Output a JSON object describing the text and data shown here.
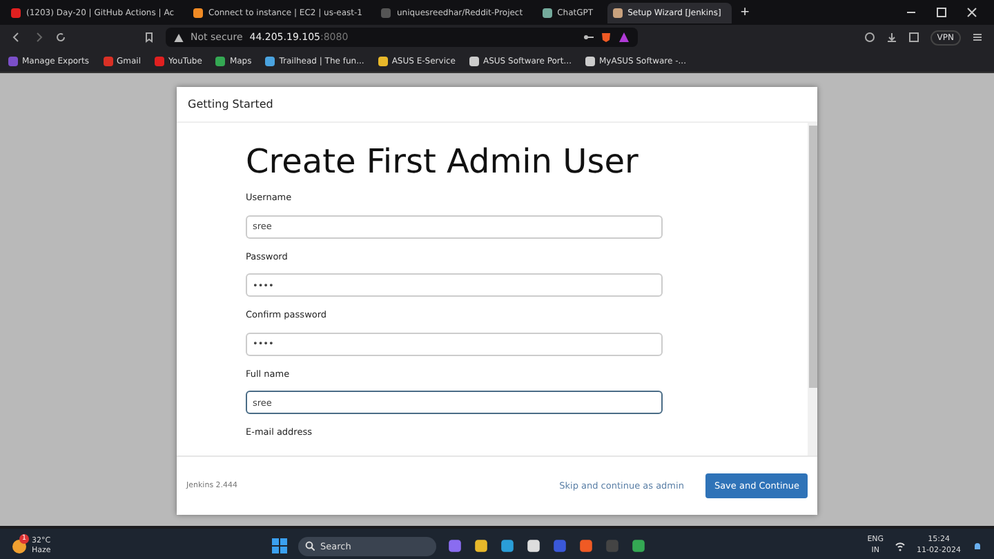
{
  "browser": {
    "tabs": [
      {
        "title": "(1203) Day-20 | GitHub Actions | Ac",
        "color": "#e02020",
        "selected": false
      },
      {
        "title": "Connect to instance | EC2 | us-east-1",
        "color": "#f08a24",
        "selected": false
      },
      {
        "title": "uniquesreedhar/Reddit-Project",
        "color": "#555555",
        "selected": false
      },
      {
        "title": "ChatGPT",
        "color": "#74aa9c",
        "selected": false
      },
      {
        "title": "Setup Wizard [Jenkins]",
        "color": "#c9a27e",
        "selected": true
      }
    ],
    "new_tab": "+",
    "security": "Not secure",
    "address": "44.205.19.105",
    "port": ":8080",
    "vpn": "VPN",
    "bookmarks": [
      {
        "label": "Manage Exports",
        "color": "#7b4fc9"
      },
      {
        "label": "Gmail",
        "color": "#d93025"
      },
      {
        "label": "YouTube",
        "color": "#e02020"
      },
      {
        "label": "Maps",
        "color": "#34a853"
      },
      {
        "label": "Trailhead | The fun...",
        "color": "#4aa3df"
      },
      {
        "label": "ASUS E-Service",
        "color": "#e8b82a"
      },
      {
        "label": "ASUS Software Port...",
        "color": "#cccccc"
      },
      {
        "label": "MyASUS Software -...",
        "color": "#cccccc"
      }
    ]
  },
  "dialog": {
    "header": "Getting Started",
    "title": "Create First Admin User",
    "fields": [
      {
        "label": "Username",
        "value": "sree",
        "focused": false
      },
      {
        "label": "Password",
        "value": "••••",
        "focused": false
      },
      {
        "label": "Confirm password",
        "value": "••••",
        "focused": false
      },
      {
        "label": "Full name",
        "value": "sree",
        "focused": true
      },
      {
        "label": "E-mail address"
      }
    ],
    "version": "Jenkins 2.444",
    "skip": "Skip and continue as admin",
    "save": "Save and Continue"
  },
  "taskbar": {
    "temperature": "32°C",
    "weather": "Haze",
    "badge": "1",
    "search": "Search",
    "language": "ENG",
    "region": "IN",
    "time": "15:24",
    "date": "11-02-2024"
  }
}
